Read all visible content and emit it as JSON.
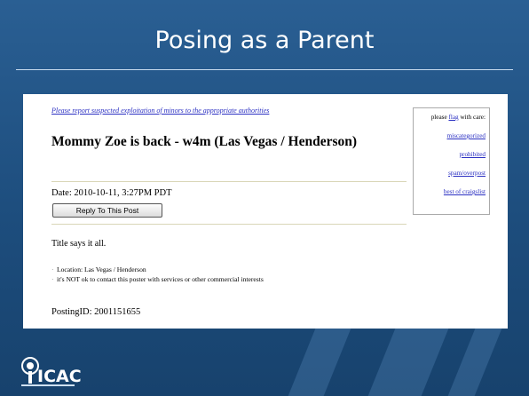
{
  "slide": {
    "title": "Posing as a Parent"
  },
  "ad": {
    "notice": "Please report suspected exploitation of minors to the appropriate authorities",
    "title": "Mommy Zoe is back - w4m (Las Vegas / Henderson)",
    "date": "Date: 2010-10-11, 3:27PM PDT",
    "reply_button": "Reply To This Post",
    "body": "Title says it all.",
    "bullets": [
      "Location: Las Vegas / Henderson",
      "it's NOT ok to contact this poster with services or other commercial interests"
    ],
    "posting_id": "PostingID: 2001151655"
  },
  "flag_panel": {
    "prefix": "please",
    "flag_word": "flag",
    "suffix": "with care:",
    "links": [
      "miscategorized",
      "prohibited",
      "spam/overpost",
      "best of craigslist"
    ]
  },
  "logo": {
    "text": "ICAC"
  },
  "colors": {
    "background": "#1f4f7c",
    "link": "#2a2fc2",
    "text_light": "#ffffff"
  }
}
